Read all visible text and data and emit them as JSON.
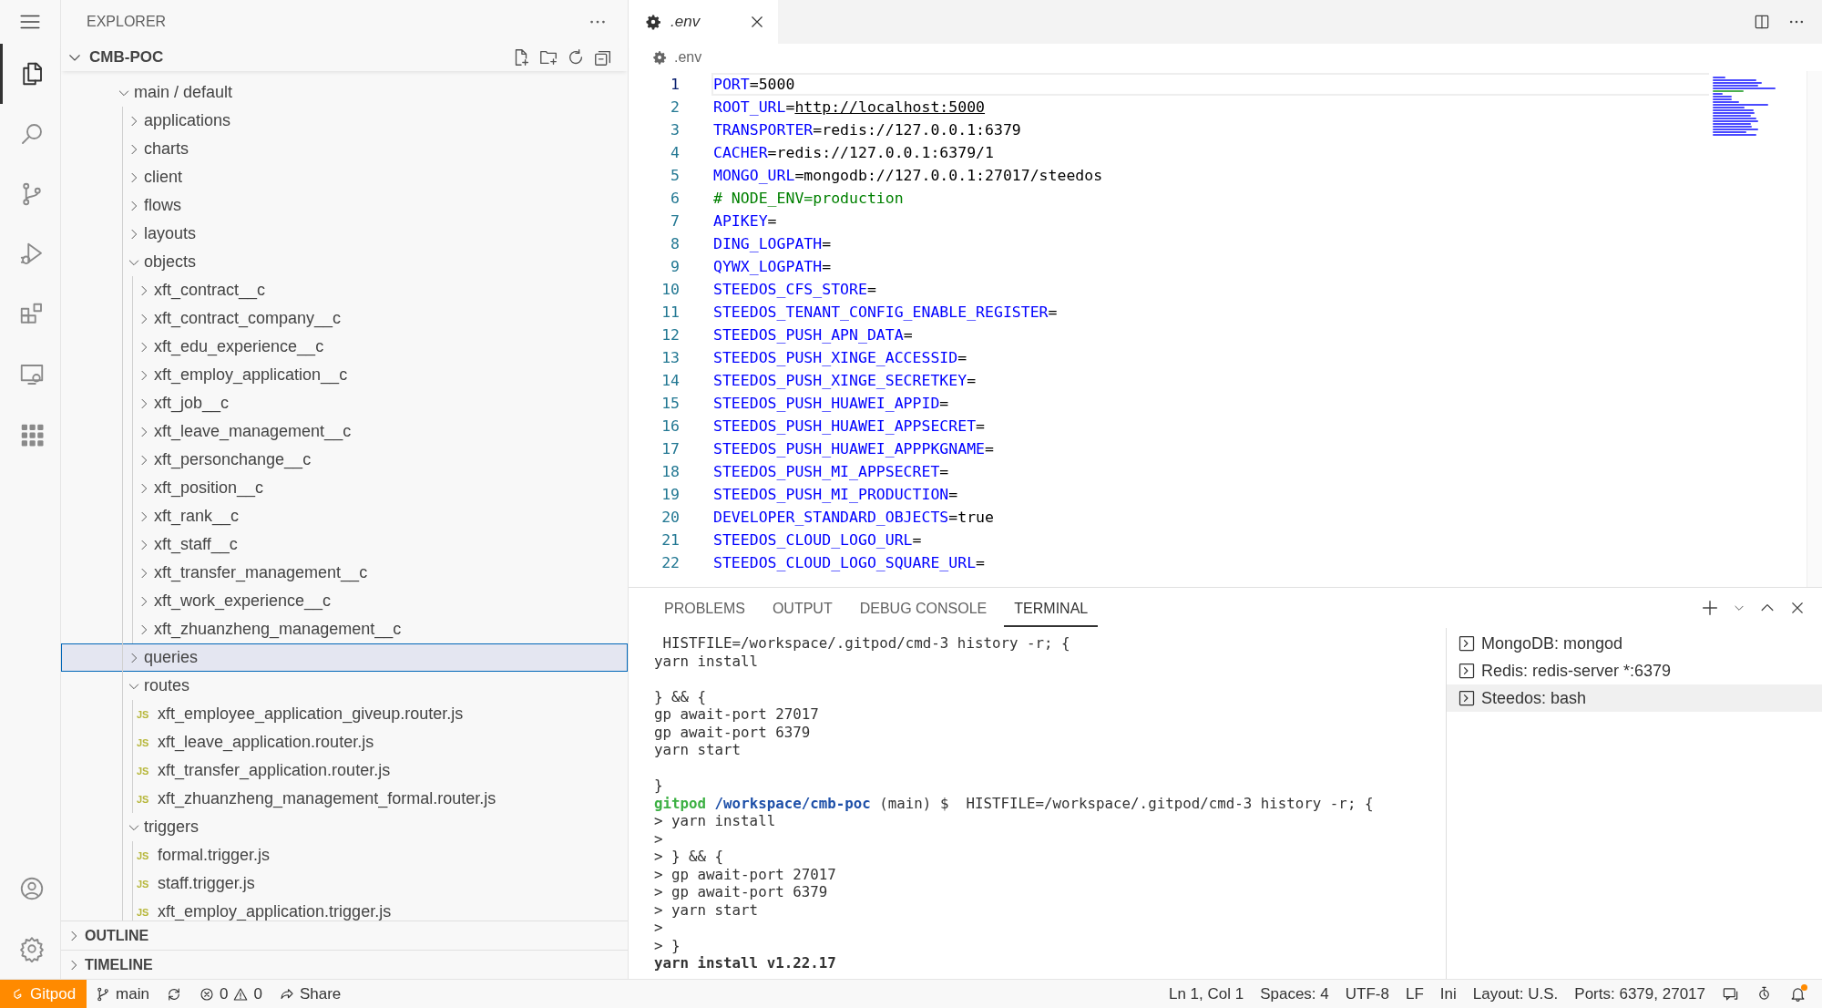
{
  "activity_bar": [
    {
      "kind": "files",
      "selected": true
    },
    {
      "kind": "search",
      "selected": false
    },
    {
      "kind": "scm",
      "selected": false
    },
    {
      "kind": "debug",
      "selected": false
    },
    {
      "kind": "extensions",
      "selected": false
    },
    {
      "kind": "remote",
      "selected": false
    },
    {
      "kind": "apps",
      "selected": false
    }
  ],
  "activity_bottom": [
    {
      "kind": "account"
    },
    {
      "kind": "gear"
    }
  ],
  "sidebar": {
    "title": "EXPLORER",
    "folder": {
      "label": "CMB-POC",
      "expanded": true
    },
    "tree": [
      {
        "label": "main / default",
        "kind": "folder",
        "expanded": true,
        "selected": false,
        "children": [
          {
            "label": "applications",
            "kind": "folder",
            "expanded": false,
            "selected": false
          },
          {
            "label": "charts",
            "kind": "folder",
            "expanded": false,
            "selected": false
          },
          {
            "label": "client",
            "kind": "folder",
            "expanded": false,
            "selected": false
          },
          {
            "label": "flows",
            "kind": "folder",
            "expanded": false,
            "selected": false
          },
          {
            "label": "layouts",
            "kind": "folder",
            "expanded": false,
            "selected": false
          },
          {
            "label": "objects",
            "kind": "folder",
            "expanded": true,
            "selected": false,
            "children": [
              {
                "label": "xft_contract__c",
                "kind": "folder",
                "expanded": false,
                "selected": false
              },
              {
                "label": "xft_contract_company__c",
                "kind": "folder",
                "expanded": false,
                "selected": false
              },
              {
                "label": "xft_edu_experience__c",
                "kind": "folder",
                "expanded": false,
                "selected": false
              },
              {
                "label": "xft_employ_application__c",
                "kind": "folder",
                "expanded": false,
                "selected": false
              },
              {
                "label": "xft_job__c",
                "kind": "folder",
                "expanded": false,
                "selected": false
              },
              {
                "label": "xft_leave_management__c",
                "kind": "folder",
                "expanded": false,
                "selected": false
              },
              {
                "label": "xft_personchange__c",
                "kind": "folder",
                "expanded": false,
                "selected": false
              },
              {
                "label": "xft_position__c",
                "kind": "folder",
                "expanded": false,
                "selected": false
              },
              {
                "label": "xft_rank__c",
                "kind": "folder",
                "expanded": false,
                "selected": false
              },
              {
                "label": "xft_staff__c",
                "kind": "folder",
                "expanded": false,
                "selected": false
              },
              {
                "label": "xft_transfer_management__c",
                "kind": "folder",
                "expanded": false,
                "selected": false
              },
              {
                "label": "xft_work_experience__c",
                "kind": "folder",
                "expanded": false,
                "selected": false
              },
              {
                "label": "xft_zhuanzheng_management__c",
                "kind": "folder",
                "expanded": false,
                "selected": false
              }
            ]
          },
          {
            "label": "queries",
            "kind": "folder",
            "expanded": false,
            "selected": true
          },
          {
            "label": "routes",
            "kind": "folder",
            "expanded": true,
            "selected": false,
            "children": [
              {
                "label": "xft_employee_application_giveup.router.js",
                "kind": "file",
                "icon_text": "JS",
                "selected": false
              },
              {
                "label": "xft_leave_application.router.js",
                "kind": "file",
                "icon_text": "JS",
                "selected": false
              },
              {
                "label": "xft_transfer_application.router.js",
                "kind": "file",
                "icon_text": "JS",
                "selected": false
              },
              {
                "label": "xft_zhuanzheng_management_formal.router.js",
                "kind": "file",
                "icon_text": "JS",
                "selected": false
              }
            ]
          },
          {
            "label": "triggers",
            "kind": "folder",
            "expanded": true,
            "selected": false,
            "children": [
              {
                "label": "formal.trigger.js",
                "kind": "file",
                "icon_text": "JS",
                "selected": false
              },
              {
                "label": "staff.trigger.js",
                "kind": "file",
                "icon_text": "JS",
                "selected": false
              },
              {
                "label": "xft_employ_application.trigger.js",
                "kind": "file",
                "icon_text": "JS",
                "selected": false
              }
            ]
          }
        ]
      }
    ],
    "sections": [
      {
        "label": "OUTLINE",
        "expanded": false
      },
      {
        "label": "TIMELINE",
        "expanded": false
      }
    ]
  },
  "editor": {
    "tab": {
      "label": ".env",
      "preview": true
    },
    "breadcrumb": ".env",
    "lines": [
      {
        "number": "1",
        "kind": "setting",
        "key": "PORT",
        "value": "=5000",
        "current": true
      },
      {
        "number": "2",
        "kind": "link",
        "key": "ROOT_URL",
        "value": "=",
        "link": "http://localhost:5000",
        "current": false
      },
      {
        "number": "3",
        "kind": "setting",
        "key": "TRANSPORTER",
        "value": "=redis://127.0.0.1:6379",
        "current": false
      },
      {
        "number": "4",
        "kind": "setting",
        "key": "CACHER",
        "value": "=redis://127.0.0.1:6379/1",
        "current": false
      },
      {
        "number": "5",
        "kind": "setting",
        "key": "MONGO_URL",
        "value": "=mongodb://127.0.0.1:27017/steedos",
        "current": false
      },
      {
        "number": "6",
        "kind": "comment",
        "text": "# NODE_ENV=production",
        "current": false
      },
      {
        "number": "7",
        "kind": "setting",
        "key": "APIKEY",
        "value": "=",
        "current": false
      },
      {
        "number": "8",
        "kind": "setting",
        "key": "DING_LOGPATH",
        "value": "=",
        "current": false
      },
      {
        "number": "9",
        "kind": "setting",
        "key": "QYWX_LOGPATH",
        "value": "=",
        "current": false
      },
      {
        "number": "10",
        "kind": "setting",
        "key": "STEEDOS_CFS_STORE",
        "value": "=",
        "current": false
      },
      {
        "number": "11",
        "kind": "setting",
        "key": "STEEDOS_TENANT_CONFIG_ENABLE_REGISTER",
        "value": "=",
        "current": false
      },
      {
        "number": "12",
        "kind": "setting",
        "key": "STEEDOS_PUSH_APN_DATA",
        "value": "=",
        "current": false
      },
      {
        "number": "13",
        "kind": "setting",
        "key": "STEEDOS_PUSH_XINGE_ACCESSID",
        "value": "=",
        "current": false
      },
      {
        "number": "14",
        "kind": "setting",
        "key": "STEEDOS_PUSH_XINGE_SECRETKEY",
        "value": "=",
        "current": false
      },
      {
        "number": "15",
        "kind": "setting",
        "key": "STEEDOS_PUSH_HUAWEI_APPID",
        "value": "=",
        "current": false
      },
      {
        "number": "16",
        "kind": "setting",
        "key": "STEEDOS_PUSH_HUAWEI_APPSECRET",
        "value": "=",
        "current": false
      },
      {
        "number": "17",
        "kind": "setting",
        "key": "STEEDOS_PUSH_HUAWEI_APPPKGNAME",
        "value": "=",
        "current": false
      },
      {
        "number": "18",
        "kind": "setting",
        "key": "STEEDOS_PUSH_MI_APPSECRET",
        "value": "=",
        "current": false
      },
      {
        "number": "19",
        "kind": "setting",
        "key": "STEEDOS_PUSH_MI_PRODUCTION",
        "value": "=",
        "current": false
      },
      {
        "number": "20",
        "kind": "setting",
        "key": "DEVELOPER_STANDARD_OBJECTS",
        "value": "=true",
        "current": false
      },
      {
        "number": "21",
        "kind": "setting",
        "key": "STEEDOS_CLOUD_LOGO_URL",
        "value": "=",
        "current": false
      },
      {
        "number": "22",
        "kind": "setting",
        "key": "STEEDOS_CLOUD_LOGO_SQUARE_URL",
        "value": "=",
        "current": false
      }
    ]
  },
  "panel": {
    "tabs": [
      {
        "label": "PROBLEMS",
        "selected": false
      },
      {
        "label": "OUTPUT",
        "selected": false
      },
      {
        "label": "DEBUG CONSOLE",
        "selected": false
      },
      {
        "label": "TERMINAL",
        "selected": true
      }
    ],
    "terminal": [
      {
        "kind": "output",
        "text": " HISTFILE=/workspace/.gitpod/cmd-3 history -r; {"
      },
      {
        "kind": "output",
        "text": "yarn install"
      },
      {
        "kind": "blank"
      },
      {
        "kind": "output",
        "text": "} && {"
      },
      {
        "kind": "output",
        "text": "gp await-port 27017"
      },
      {
        "kind": "output",
        "text": "gp await-port 6379"
      },
      {
        "kind": "output",
        "text": "yarn start"
      },
      {
        "kind": "blank"
      },
      {
        "kind": "output",
        "text": "}"
      },
      {
        "kind": "prompt",
        "user": "gitpod",
        "path": "/workspace/cmb-poc",
        "text": " (main) $  HISTFILE=/workspace/.gitpod/cmd-3 history -r; {"
      },
      {
        "kind": "output",
        "text": "> yarn install"
      },
      {
        "kind": "output",
        "text": ">"
      },
      {
        "kind": "output",
        "text": "> } && {"
      },
      {
        "kind": "output",
        "text": "> gp await-port 27017"
      },
      {
        "kind": "output",
        "text": "> gp await-port 6379"
      },
      {
        "kind": "output",
        "text": "> yarn start"
      },
      {
        "kind": "output",
        "text": ">"
      },
      {
        "kind": "output",
        "text": "> }"
      },
      {
        "kind": "bold",
        "text": "yarn install v1.22.17"
      }
    ],
    "terminals": [
      {
        "label": "MongoDB: mongod",
        "selected": false
      },
      {
        "label": "Redis: redis-server *:6379",
        "selected": false
      },
      {
        "label": "Steedos: bash",
        "selected": true
      }
    ]
  },
  "status_bar": {
    "left": [
      {
        "kind": "remote",
        "text": "Gitpod"
      },
      {
        "kind": "branch",
        "text": "main"
      },
      {
        "kind": "sync"
      },
      {
        "kind": "problems",
        "errors": "0",
        "warnings": "0"
      },
      {
        "kind": "share",
        "text": "Share"
      }
    ],
    "right": [
      {
        "kind": "text",
        "text": "Ln 1, Col 1"
      },
      {
        "kind": "text",
        "text": "Spaces: 4"
      },
      {
        "kind": "text",
        "text": "UTF-8"
      },
      {
        "kind": "text",
        "text": "LF"
      },
      {
        "kind": "text",
        "text": "Ini"
      },
      {
        "kind": "text",
        "text": "Layout: U.S."
      },
      {
        "kind": "text",
        "text": "Ports: 6379, 27017"
      },
      {
        "kind": "feedback"
      },
      {
        "kind": "timer"
      },
      {
        "kind": "bell"
      }
    ]
  }
}
